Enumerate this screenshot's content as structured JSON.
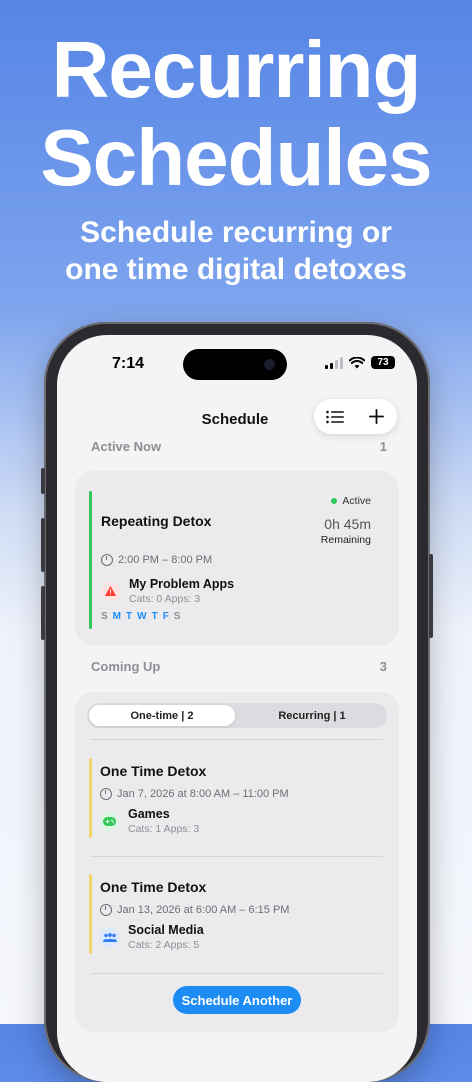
{
  "hero": {
    "title_line1": "Recurring",
    "title_line2": "Schedules",
    "subtitle_line1": "Schedule recurring or",
    "subtitle_line2": "one time digital detoxes"
  },
  "status_bar": {
    "time": "7:14",
    "battery": "73"
  },
  "nav": {
    "title": "Schedule",
    "list_icon": "list-icon",
    "add_icon": "plus-icon"
  },
  "active_now": {
    "header": "Active Now",
    "count": "1",
    "card": {
      "title": "Repeating Detox",
      "status": "Active",
      "remaining_value": "0h 45m",
      "remaining_label": "Remaining",
      "time_range": "2:00 PM – 8:00 PM",
      "group_name": "My Problem Apps",
      "group_sub": "Cats: 0   Apps: 3",
      "group_icon": "warning-icon",
      "days": [
        "S",
        "M",
        "T",
        "W",
        "T",
        "F",
        "S"
      ],
      "days_active": [
        false,
        true,
        true,
        true,
        true,
        true,
        false
      ]
    }
  },
  "coming_up": {
    "header": "Coming Up",
    "count": "3",
    "segments": [
      "One-time  |  2",
      "Recurring  |  1"
    ],
    "selected_segment": 0,
    "items": [
      {
        "title": "One Time Detox",
        "date": "Jan 7, 2026 at 8:00 AM – 11:00 PM",
        "group_name": "Games",
        "group_sub": "Cats: 1   Apps: 3",
        "group_icon": "gamepad-icon"
      },
      {
        "title": "One Time Detox",
        "date": "Jan 13, 2026 at 6:00 AM – 6:15 PM",
        "group_name": "Social Media",
        "group_sub": "Cats: 2   Apps: 5",
        "group_icon": "people-icon"
      }
    ],
    "button_label": "Schedule Another"
  },
  "colors": {
    "accent": "#1e8cf5",
    "active_green": "#34c759",
    "upcoming_yellow": "#f3d36b",
    "warning_red": "#ff3b30",
    "games_green": "#34c759",
    "social_blue": "#2f7bf5"
  }
}
